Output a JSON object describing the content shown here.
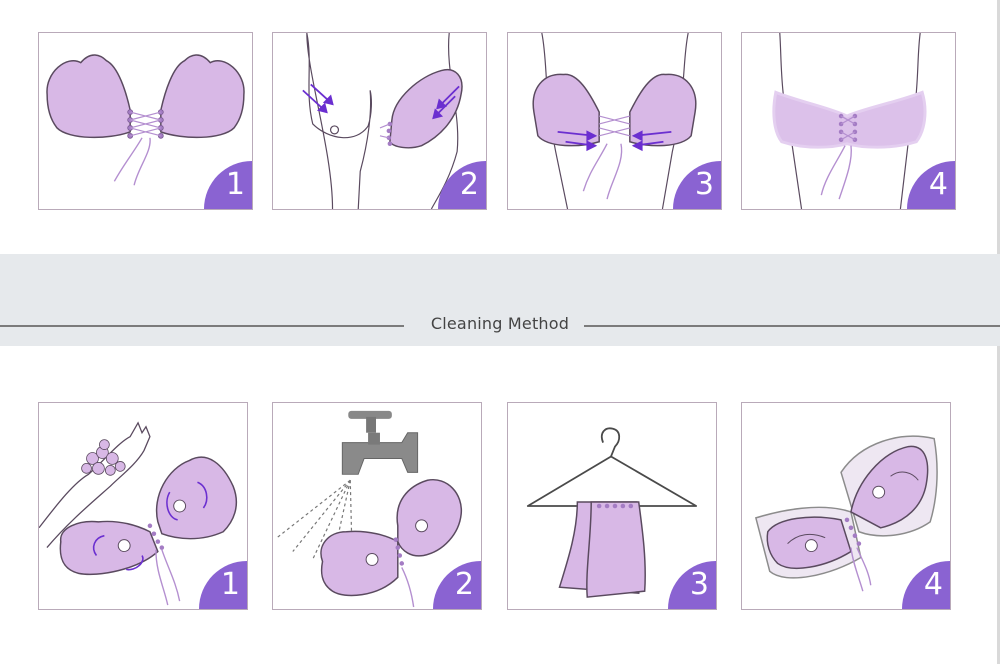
{
  "colors": {
    "cup_fill": "#d8b8e6",
    "cup_stroke": "#5a4a5f",
    "accent": "#8a63d2",
    "arrow": "#6b2fd0",
    "band": "#e6e9ec"
  },
  "wearing_steps": [
    {
      "number": "1",
      "icon": "separated-cups-icon"
    },
    {
      "number": "2",
      "icon": "place-cup-icon"
    },
    {
      "number": "3",
      "icon": "pull-laces-icon"
    },
    {
      "number": "4",
      "icon": "worn-bra-icon"
    }
  ],
  "section": {
    "title": "Cleaning Method"
  },
  "cleaning_steps": [
    {
      "number": "1",
      "icon": "soap-wash-icon"
    },
    {
      "number": "2",
      "icon": "rinse-tap-icon"
    },
    {
      "number": "3",
      "icon": "hanger-dry-icon"
    },
    {
      "number": "4",
      "icon": "storage-film-icon"
    }
  ]
}
